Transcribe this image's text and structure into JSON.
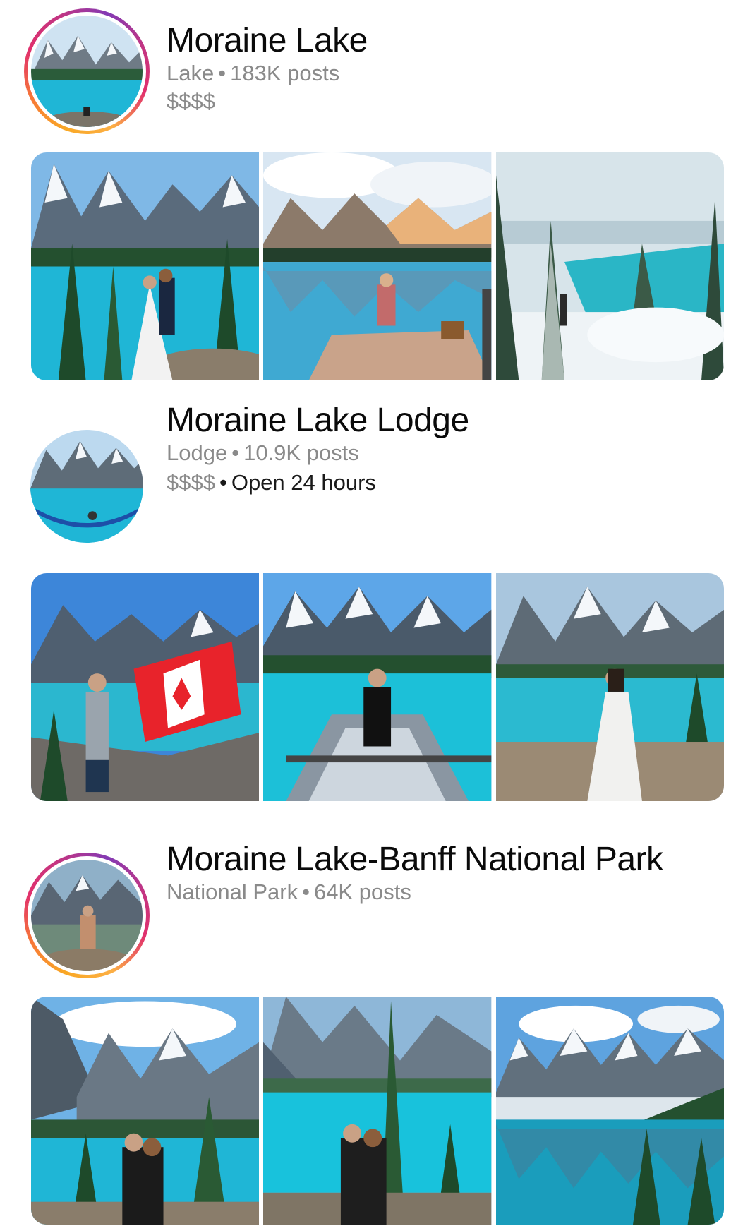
{
  "places": [
    {
      "name": "Moraine Lake",
      "category": "Lake",
      "separator": "•",
      "posts": "183K posts",
      "price": "$$$$",
      "extra": "",
      "has_story_ring": true,
      "photos": [
        {
          "scene": "wedding couple by turquoise lake"
        },
        {
          "scene": "woman picnicking with lake reflection"
        },
        {
          "scene": "snowy forest by lake"
        }
      ]
    },
    {
      "name": "Moraine Lake Lodge",
      "category": "Lodge",
      "separator": "•",
      "posts": "10.9K posts",
      "price": "$$$$",
      "extra": "Open 24 hours",
      "has_story_ring": false,
      "photos": [
        {
          "scene": "man holding Canadian flag"
        },
        {
          "scene": "woman sitting in canoe"
        },
        {
          "scene": "woman in white dress by lake"
        }
      ]
    },
    {
      "name": "Moraine Lake-Banff National Park",
      "category": "National Park",
      "separator": "•",
      "posts": "64K posts",
      "price": "",
      "extra": "",
      "has_story_ring": true,
      "photos": [
        {
          "scene": "couple hugging by lake"
        },
        {
          "scene": "couple posing at lake"
        },
        {
          "scene": "lake reflection with peaks"
        }
      ]
    }
  ],
  "colors": {
    "lake": "#1fb6d6",
    "lake_deep": "#0f8fb5",
    "sky": "#6fb6e8",
    "mountain": "#5d6d7e",
    "snow": "#f4f7fa",
    "forest": "#1f4a2e",
    "ring_start": "#f9a825",
    "ring_end": "#c13584"
  }
}
